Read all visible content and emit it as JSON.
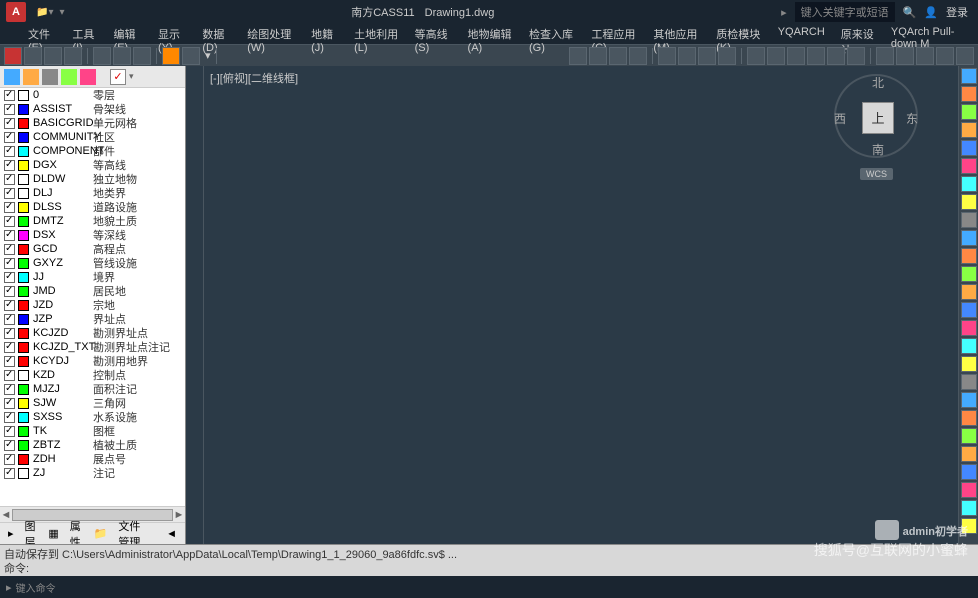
{
  "title": {
    "app": "南方CASS11",
    "file": "Drawing1.dwg"
  },
  "search": {
    "placeholder": "键入关键字或短语"
  },
  "login": "登录",
  "menus": [
    "文件(E)",
    "工具(I)",
    "编辑(E)",
    "显示(Y)",
    "数据(D)",
    "绘图处理(W)",
    "地籍(J)",
    "土地利用(L)",
    "等高线(S)",
    "地物编辑(A)",
    "检查入库(G)",
    "工程应用(C)",
    "其他应用(M)",
    "质检模块(K)",
    "YQARCH",
    "原来设计",
    "YQArch Pull-down M"
  ],
  "canvas_label": "[-][俯视][二维线框]",
  "viewcube": {
    "top": "北",
    "right": "东",
    "bottom": "南",
    "left": "西",
    "face": "上",
    "wcs": "WCS"
  },
  "layers": [
    {
      "c": "#ffffff",
      "n": "0",
      "d": "零层"
    },
    {
      "c": "#0000ff",
      "n": "ASSIST",
      "d": "骨架线"
    },
    {
      "c": "#ff0000",
      "n": "BASICGRID",
      "d": "单元网格"
    },
    {
      "c": "#0000ff",
      "n": "COMMUNITY",
      "d": "社区"
    },
    {
      "c": "#00ffff",
      "n": "COMPONENT",
      "d": "部件"
    },
    {
      "c": "#ffff00",
      "n": "DGX",
      "d": "等高线"
    },
    {
      "c": "#ffffff",
      "n": "DLDW",
      "d": "独立地物"
    },
    {
      "c": "#ffffff",
      "n": "DLJ",
      "d": "地类界"
    },
    {
      "c": "#ffff00",
      "n": "DLSS",
      "d": "道路设施"
    },
    {
      "c": "#00ff00",
      "n": "DMTZ",
      "d": "地貌土质"
    },
    {
      "c": "#ff00ff",
      "n": "DSX",
      "d": "等深线"
    },
    {
      "c": "#ff0000",
      "n": "GCD",
      "d": "高程点"
    },
    {
      "c": "#00ff00",
      "n": "GXYZ",
      "d": "管线设施"
    },
    {
      "c": "#00ffff",
      "n": "JJ",
      "d": "境界"
    },
    {
      "c": "#00ff00",
      "n": "JMD",
      "d": "居民地"
    },
    {
      "c": "#ff0000",
      "n": "JZD",
      "d": "宗地"
    },
    {
      "c": "#0000ff",
      "n": "JZP",
      "d": "界址点"
    },
    {
      "c": "#ff0000",
      "n": "KCJZD",
      "d": "勘测界址点"
    },
    {
      "c": "#ff0000",
      "n": "KCJZD_TXT",
      "d": "勘测界址点注记"
    },
    {
      "c": "#ff0000",
      "n": "KCYDJ",
      "d": "勘测用地界"
    },
    {
      "c": "#ffffff",
      "n": "KZD",
      "d": "控制点"
    },
    {
      "c": "#00ff00",
      "n": "MJZJ",
      "d": "面积注记"
    },
    {
      "c": "#ffff00",
      "n": "SJW",
      "d": "三角网"
    },
    {
      "c": "#00ffff",
      "n": "SXSS",
      "d": "水系设施"
    },
    {
      "c": "#00ff00",
      "n": "TK",
      "d": "图框"
    },
    {
      "c": "#00ff00",
      "n": "ZBTZ",
      "d": "植被土质"
    },
    {
      "c": "#ff0000",
      "n": "ZDH",
      "d": "展点号"
    },
    {
      "c": "#ffffff",
      "n": "ZJ",
      "d": "注记"
    }
  ],
  "panel_tabs": {
    "layer": "图层",
    "attr": "属性",
    "file": "文件管理"
  },
  "cmd": {
    "autosave": "自动保存到 C:\\Users\\Administrator\\AppData\\Local\\Temp\\Drawing1_1_29060_9a86fdfc.sv$ ...",
    "label": "命令:",
    "placeholder": "键入命令"
  },
  "watermark": {
    "line1": "admin初学者",
    "line2": "搜狐号@互联网的小蜜蜂"
  }
}
